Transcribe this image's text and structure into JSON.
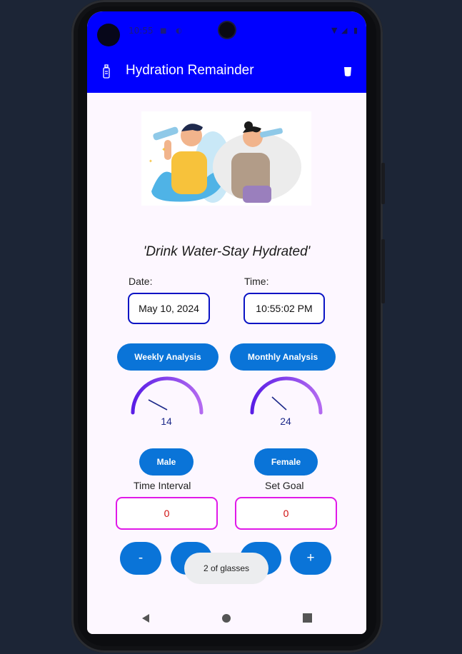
{
  "status": {
    "time": "10:55"
  },
  "appbar": {
    "title": "Hydration Remainder"
  },
  "tagline": "'Drink Water-Stay Hydrated'",
  "date": {
    "label": "Date:",
    "value": "May 10, 2024"
  },
  "time": {
    "label": "Time:",
    "value": "10:55:02 PM"
  },
  "analysis": {
    "weekly": {
      "label": "Weekly Analysis",
      "value": "14"
    },
    "monthly": {
      "label": "Monthly Analysis",
      "value": "24"
    }
  },
  "gender": {
    "male": "Male",
    "female": "Female"
  },
  "interval": {
    "label": "Time Interval",
    "value": "0"
  },
  "goal": {
    "label": "Set Goal",
    "value": "0"
  },
  "controls": {
    "minus": "-",
    "plus": "+"
  },
  "toast": "2 of glasses",
  "icons": {
    "app": "bottle-icon",
    "menu": "cup-icon",
    "back": "nav-back-icon",
    "home": "nav-home-icon",
    "recents": "nav-recents-icon"
  },
  "colors": {
    "appbar": "#0000ff",
    "button": "#0a74d8",
    "field_border": "#0a13c4",
    "input_border": "#e019e8",
    "input_value": "#d01010"
  }
}
